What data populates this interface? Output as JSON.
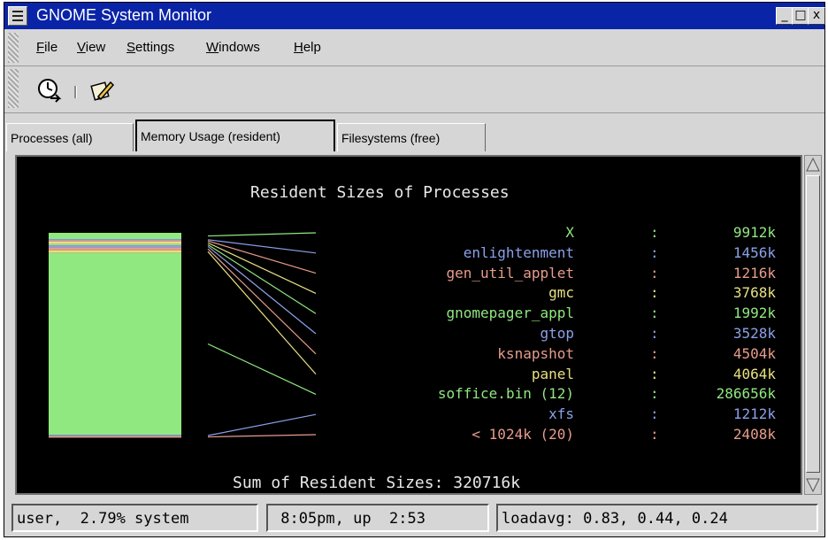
{
  "window": {
    "title": "GNOME System Monitor",
    "controls": {
      "minimize": "_",
      "maximize": "□",
      "close": "x"
    }
  },
  "menubar": {
    "items": [
      {
        "label": "File",
        "mnemonic": "F",
        "rest": "ile"
      },
      {
        "label": "View",
        "mnemonic": "V",
        "rest": "iew"
      },
      {
        "label": "Settings",
        "mnemonic": "S",
        "rest": "ettings"
      },
      {
        "label": "Windows",
        "mnemonic": "W",
        "rest": "indows"
      },
      {
        "label": "Help",
        "mnemonic": "H",
        "rest": "elp"
      }
    ]
  },
  "toolbar": {
    "icons": [
      "refresh-clock-icon",
      "edit-pencil-icon"
    ]
  },
  "tabs": [
    {
      "label": "Processes (all)",
      "active": false
    },
    {
      "label": "Memory Usage (resident)",
      "active": true
    },
    {
      "label": "Filesystems (free)",
      "active": false
    }
  ],
  "chart_data": {
    "type": "bar",
    "title": "Resident Sizes of Processes",
    "unit": "k",
    "colors": {
      "green": "#90e880",
      "blue": "#8ca0e8",
      "salmon": "#e89c8c",
      "yellow": "#e8e080",
      "background": "#000000"
    },
    "categories": [
      "X",
      "enlightenment",
      "gen_util_applet",
      "gmc",
      "gnomepager_appl",
      "gtop",
      "ksnapshot",
      "panel",
      "soffice.bin (12)",
      "xfs",
      "< 1024k (20)"
    ],
    "values": [
      9912,
      1456,
      1216,
      3768,
      1992,
      3528,
      4504,
      4064,
      286656,
      1212,
      2408
    ],
    "labels": [
      "9912k",
      "1456k",
      "1216k",
      "3768k",
      "1992k",
      "3528k",
      "4504k",
      "4064k",
      "286656k",
      "1212k",
      "2408k"
    ],
    "series_colors": [
      "green",
      "blue",
      "salmon",
      "yellow",
      "green",
      "blue",
      "salmon",
      "yellow",
      "green",
      "blue",
      "salmon"
    ],
    "separator": ":",
    "sum_label": "Sum of Resident Sizes: 320716k",
    "total": 320716
  },
  "statusbar": {
    "cpu": "user,  2.79% system",
    "uptime": " 8:05pm, up  2:53",
    "loadavg": "loadavg: 0.83, 0.44, 0.24"
  }
}
